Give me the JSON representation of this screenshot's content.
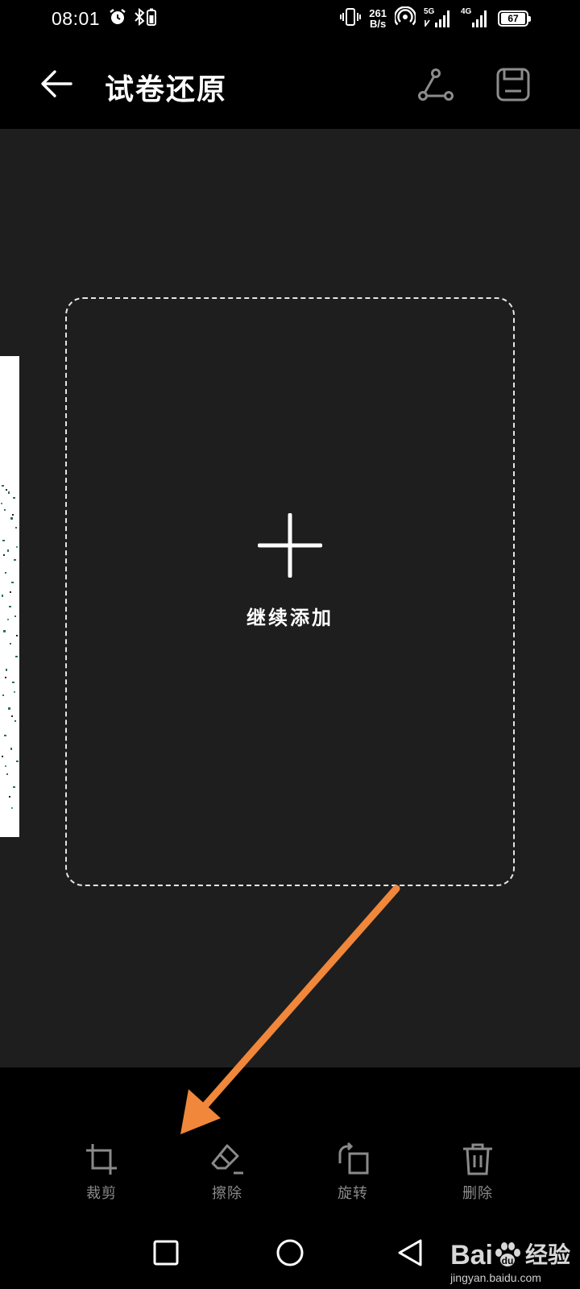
{
  "status_bar": {
    "time": "08:01",
    "net_speed_value": "261",
    "net_speed_unit": "B/s",
    "sim1_tag": "5G",
    "sim2_tag": "4G",
    "battery": "67"
  },
  "app_bar": {
    "title": "试卷还原",
    "icons": [
      "back-arrow-icon",
      "share-icon",
      "save-icon"
    ]
  },
  "canvas": {
    "add_more_label": "继续添加"
  },
  "toolbar": {
    "items": [
      {
        "label": "裁剪",
        "icon": "crop-icon"
      },
      {
        "label": "擦除",
        "icon": "eraser-icon"
      },
      {
        "label": "旋转",
        "icon": "rotate-icon"
      },
      {
        "label": "删除",
        "icon": "trash-icon"
      }
    ]
  },
  "nav_bar": {
    "icons": [
      "recents-square-icon",
      "home-circle-icon",
      "back-triangle-icon"
    ]
  },
  "watermark": {
    "logo_text": "Bai",
    "logo_suffix": "经验",
    "url": "jingyan.baidu.com"
  },
  "colors": {
    "annotation_arrow": "#f0873a",
    "canvas_bg": "#1e1e1e",
    "toolbar_label": "#8a8a8a"
  }
}
